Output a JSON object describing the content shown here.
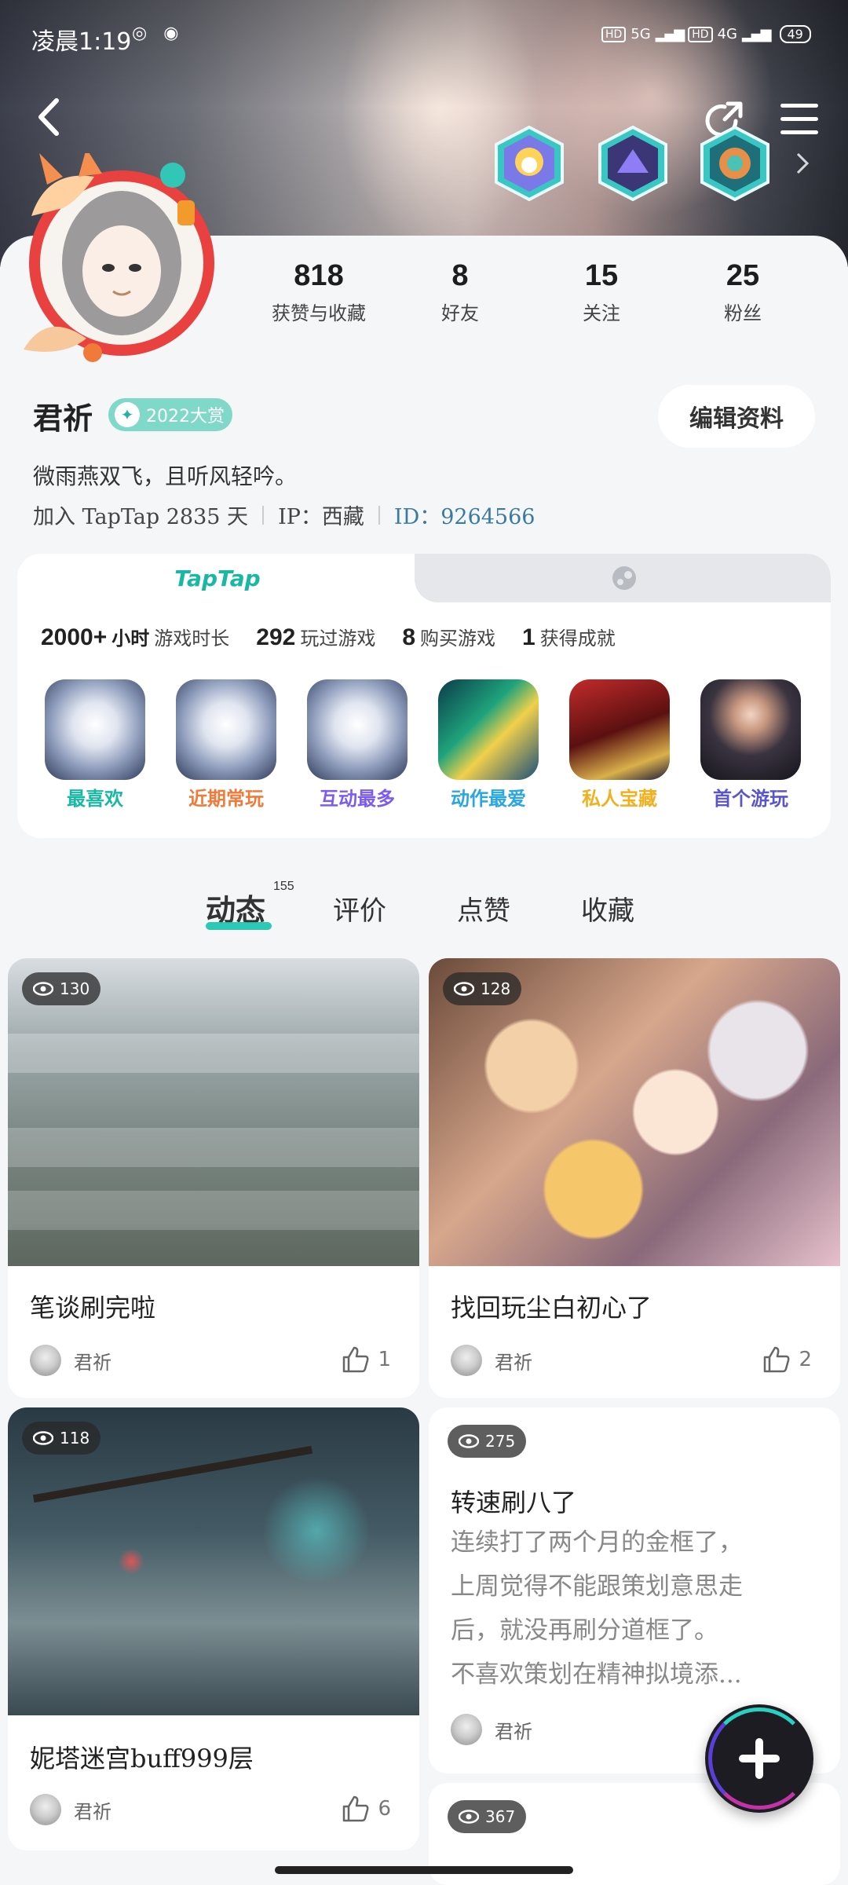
{
  "status_bar": {
    "time": "凌晨1:19",
    "network_1": "5G",
    "network_2": "4G",
    "battery": "49"
  },
  "profile": {
    "name": "君祈",
    "award": "2022大赏",
    "bio": "微雨燕双飞，且听风轻吟。",
    "joined": "加入 TapTap 2835 天",
    "ip": "IP：西藏",
    "id": "ID：9264566",
    "edit_button": "编辑资料"
  },
  "stats": [
    {
      "num": "818",
      "label": "获赞与收藏"
    },
    {
      "num": "8",
      "label": "好友"
    },
    {
      "num": "15",
      "label": "关注"
    },
    {
      "num": "25",
      "label": "粉丝"
    }
  ],
  "game_card": {
    "tab_label": "TapTap",
    "hours_num": "2000+",
    "hours_unit": "小时",
    "hours_label": "游戏时长",
    "played_num": "292",
    "played_label": "玩过游戏",
    "bought_num": "8",
    "bought_label": "购买游戏",
    "ach_num": "1",
    "ach_label": "获得成就",
    "games": [
      {
        "label": "最喜欢",
        "color": "#18b8a5"
      },
      {
        "label": "近期常玩",
        "color": "#f07a3a"
      },
      {
        "label": "互动最多",
        "color": "#7c5cf0"
      },
      {
        "label": "动作最爱",
        "color": "#2aa6e0"
      },
      {
        "label": "私人宝藏",
        "color": "#f0b020"
      },
      {
        "label": "首个游玩",
        "color": "#5a56c8"
      }
    ]
  },
  "tabs": {
    "dynamic": "动态",
    "dynamic_count": "155",
    "review": "评价",
    "like": "点赞",
    "collect": "收藏"
  },
  "posts": [
    {
      "views": "130",
      "title": "笔谈刷完啦",
      "author": "君祈",
      "likes": "1"
    },
    {
      "views": "128",
      "title": "找回玩尘白初心了",
      "author": "君祈",
      "likes": "2"
    },
    {
      "views": "118",
      "title": "妮塔迷宫buff999层",
      "author": "君祈",
      "likes": "6"
    },
    {
      "views": "275",
      "title": "转速刷八了",
      "author": "君祈",
      "text_1": "连续打了两个月的金框了，",
      "text_2": "上周觉得不能跟策划意思走",
      "text_3": "后，就没再刷分道框了。",
      "text_4": "不喜欢策划在精神拟境添..."
    },
    {
      "views": "367"
    }
  ]
}
